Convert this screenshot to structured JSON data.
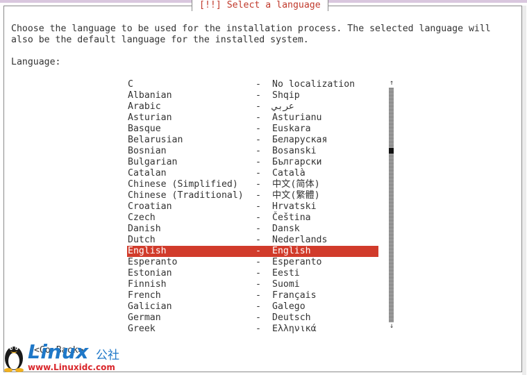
{
  "dialog": {
    "title": "[!!] Select a language",
    "instruction_line1": "Choose the language to be used for the installation process. The selected language will",
    "instruction_line2": "also be the default language for the installed system.",
    "language_label": "Language:"
  },
  "languages": [
    {
      "name": "C",
      "dash": "-",
      "native": "No localization"
    },
    {
      "name": "Albanian",
      "dash": "-",
      "native": "Shqip"
    },
    {
      "name": "Arabic",
      "dash": "-",
      "native": "عربي"
    },
    {
      "name": "Asturian",
      "dash": "-",
      "native": "Asturianu"
    },
    {
      "name": "Basque",
      "dash": "-",
      "native": "Euskara"
    },
    {
      "name": "Belarusian",
      "dash": "-",
      "native": "Беларуская"
    },
    {
      "name": "Bosnian",
      "dash": "-",
      "native": "Bosanski"
    },
    {
      "name": "Bulgarian",
      "dash": "-",
      "native": "Български"
    },
    {
      "name": "Catalan",
      "dash": "-",
      "native": "Català"
    },
    {
      "name": "Chinese (Simplified)",
      "dash": "-",
      "native": "中文(简体)"
    },
    {
      "name": "Chinese (Traditional)",
      "dash": "-",
      "native": "中文(繁體)"
    },
    {
      "name": "Croatian",
      "dash": "-",
      "native": "Hrvatski"
    },
    {
      "name": "Czech",
      "dash": "-",
      "native": "Čeština"
    },
    {
      "name": "Danish",
      "dash": "-",
      "native": "Dansk"
    },
    {
      "name": "Dutch",
      "dash": "-",
      "native": "Nederlands"
    },
    {
      "name": "English",
      "dash": "-",
      "native": "English"
    },
    {
      "name": "Esperanto",
      "dash": "-",
      "native": "Esperanto"
    },
    {
      "name": "Estonian",
      "dash": "-",
      "native": "Eesti"
    },
    {
      "name": "Finnish",
      "dash": "-",
      "native": "Suomi"
    },
    {
      "name": "French",
      "dash": "-",
      "native": "Français"
    },
    {
      "name": "Galician",
      "dash": "-",
      "native": "Galego"
    },
    {
      "name": "German",
      "dash": "-",
      "native": "Deutsch"
    },
    {
      "name": "Greek",
      "dash": "-",
      "native": "Ελληνικά"
    }
  ],
  "selected_language": "English",
  "scrollbar": {
    "up_arrow": "↑",
    "down_arrow": "↓"
  },
  "go_back_label": "<Go Back>",
  "watermark": {
    "logo_text": "Linux",
    "logo_cn": "公社",
    "url": "www.Linuxidc.com"
  },
  "colors": {
    "title": "#c0392b",
    "selection_bg": "#d13b2b",
    "selection_fg": "#ffffff",
    "text": "#333333",
    "watermark_blue": "#1f78c8",
    "watermark_red": "#d9262b"
  }
}
